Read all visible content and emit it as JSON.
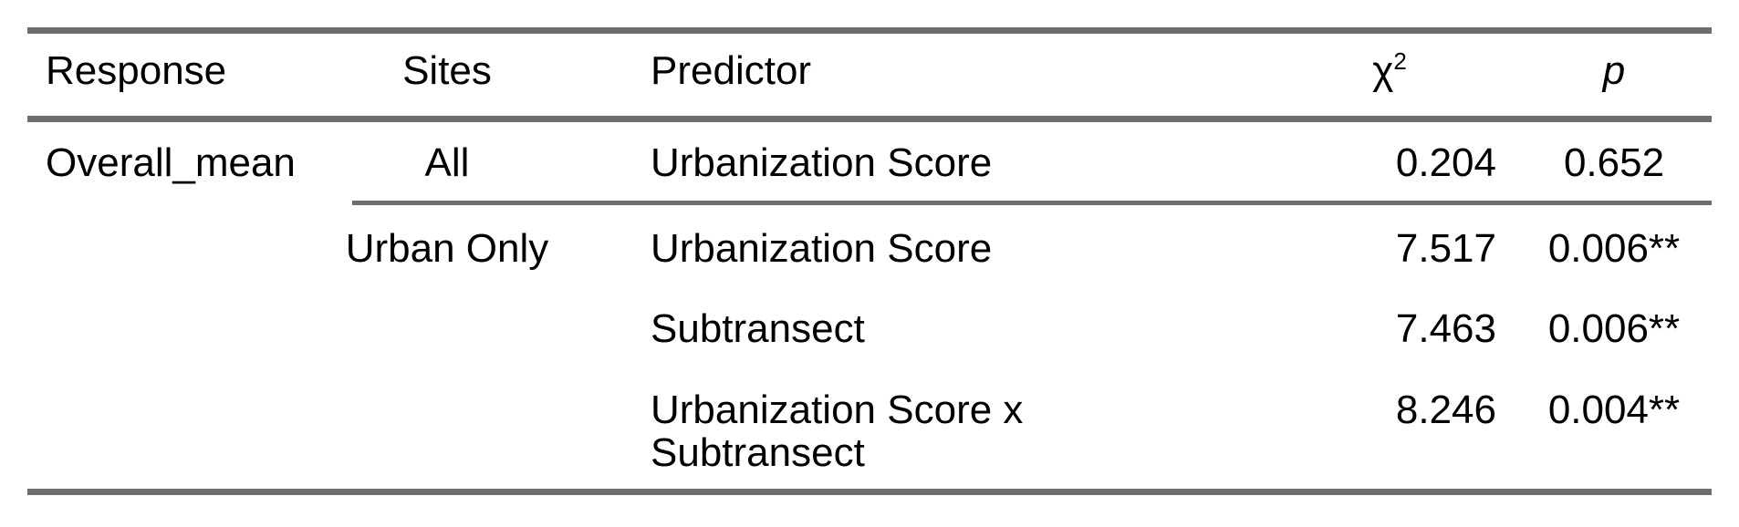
{
  "table": {
    "header": {
      "response": "Response",
      "sites": "Sites",
      "predictor": "Predictor",
      "chi2": "χ",
      "chi2_sup": "2",
      "p": "p"
    },
    "rows": [
      {
        "response": "Overall_mean",
        "sites": "All",
        "predictor": "Urbanization Score",
        "chi2": "0.204",
        "p": "0.652"
      },
      {
        "response": "",
        "sites": "Urban Only",
        "predictor": "Urbanization Score",
        "chi2": "7.517",
        "p": "0.006**"
      },
      {
        "response": "",
        "sites": "",
        "predictor": "Subtransect",
        "chi2": "7.463",
        "p": "0.006**"
      },
      {
        "response": "",
        "sites": "",
        "predictor_line1": "Urbanization Score x",
        "predictor_line2": "Subtransect",
        "chi2": "8.246",
        "p": "0.004**"
      }
    ]
  }
}
